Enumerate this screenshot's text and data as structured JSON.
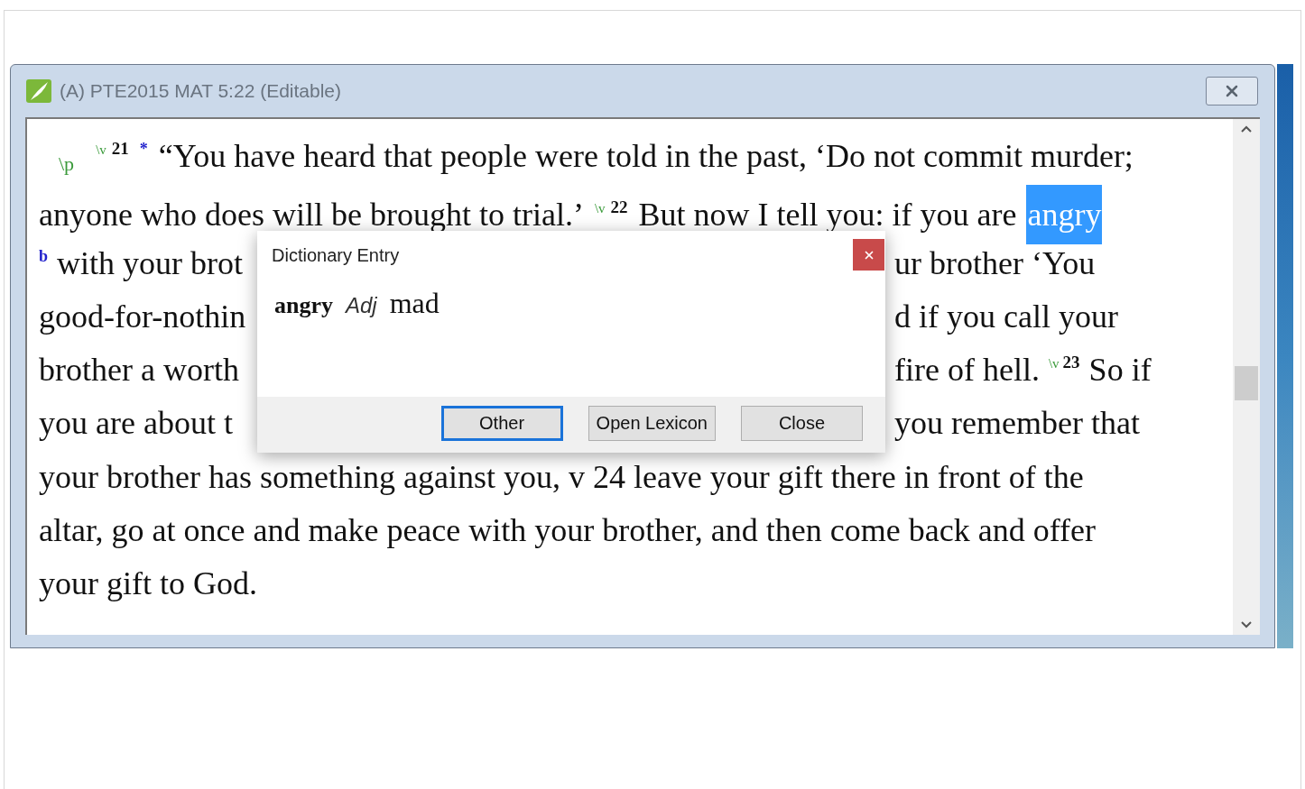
{
  "window": {
    "title": "(A) PTE2015 MAT 5:22 (Editable)"
  },
  "editor": {
    "lines": [
      {
        "segments": [
          {
            "kind": "para_marker",
            "text": "\\p"
          },
          {
            "kind": "verse_marker",
            "text": "\\v"
          },
          {
            "kind": "verse",
            "text": "21"
          },
          {
            "kind": "note",
            "text": "*"
          },
          {
            "kind": "text",
            "text": "“You have heard that people were told in the past, ‘Do not commit murder;"
          }
        ]
      },
      {
        "segments": [
          {
            "kind": "text",
            "text": "anyone who does will be brought to trial.’"
          },
          {
            "kind": "verse_marker",
            "text": "\\v"
          },
          {
            "kind": "verse",
            "text": "22"
          },
          {
            "kind": "text",
            "text": "But now I tell you: if you are"
          },
          {
            "kind": "selected",
            "text": "angry"
          }
        ]
      },
      {
        "segments": [
          {
            "kind": "note",
            "text": "b"
          },
          {
            "kind": "text",
            "text": "with your brot"
          }
        ],
        "right": [
          {
            "kind": "text",
            "text": "ur brother ‘You"
          }
        ]
      },
      {
        "segments": [
          {
            "kind": "text",
            "text": "good-for-nothin"
          }
        ],
        "right": [
          {
            "kind": "text",
            "text": "d if you call your"
          }
        ]
      },
      {
        "segments": [
          {
            "kind": "text",
            "text": "brother a worth"
          }
        ],
        "right": [
          {
            "kind": "text",
            "text": "fire of hell."
          },
          {
            "kind": "verse_marker",
            "text": "\\v"
          },
          {
            "kind": "verse",
            "text": "23"
          },
          {
            "kind": "text",
            "text": "So if"
          }
        ]
      },
      {
        "segments": [
          {
            "kind": "text",
            "text": "you are about t"
          }
        ],
        "right": [
          {
            "kind": "text",
            "text": "you remember that"
          }
        ]
      },
      {
        "segments": [
          {
            "kind": "text",
            "text": "your brother has something against you, v 24 leave your gift there in front of the"
          }
        ]
      },
      {
        "segments": [
          {
            "kind": "text",
            "text": "altar, go at once and make peace with your brother, and then come back and offer"
          }
        ]
      },
      {
        "segments": [
          {
            "kind": "text",
            "text": "your gift to God."
          }
        ]
      }
    ]
  },
  "dialog": {
    "title": "Dictionary Entry",
    "word": "angry",
    "part_of_speech": "Adj",
    "gloss": "mad",
    "buttons": [
      {
        "label": "Other",
        "focused": true
      },
      {
        "label": "Open Lexicon",
        "focused": false
      },
      {
        "label": "Close",
        "focused": false
      }
    ]
  }
}
